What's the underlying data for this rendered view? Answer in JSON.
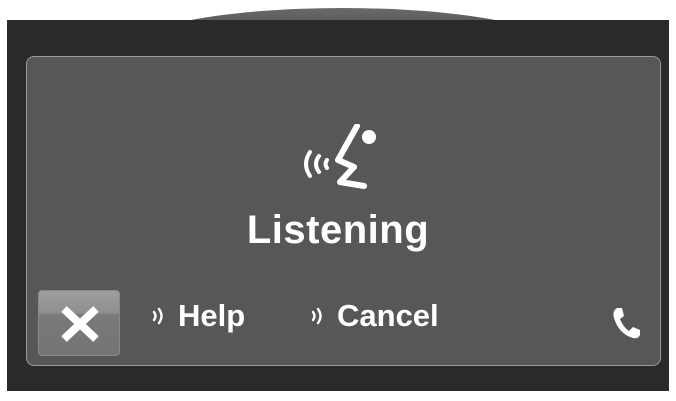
{
  "status": {
    "text": "Listening"
  },
  "commands": [
    {
      "label": "Help",
      "icon": "voice-prompt-icon"
    },
    {
      "label": "Cancel",
      "icon": "voice-prompt-icon"
    }
  ],
  "buttons": {
    "close": {
      "icon": "close-icon"
    },
    "phone": {
      "icon": "phone-icon"
    }
  },
  "icons": {
    "main": "voice-recognition-icon"
  },
  "colors": {
    "screen_bg": "#575757",
    "bezel": "#2a2a2a",
    "text": "#ffffff"
  }
}
